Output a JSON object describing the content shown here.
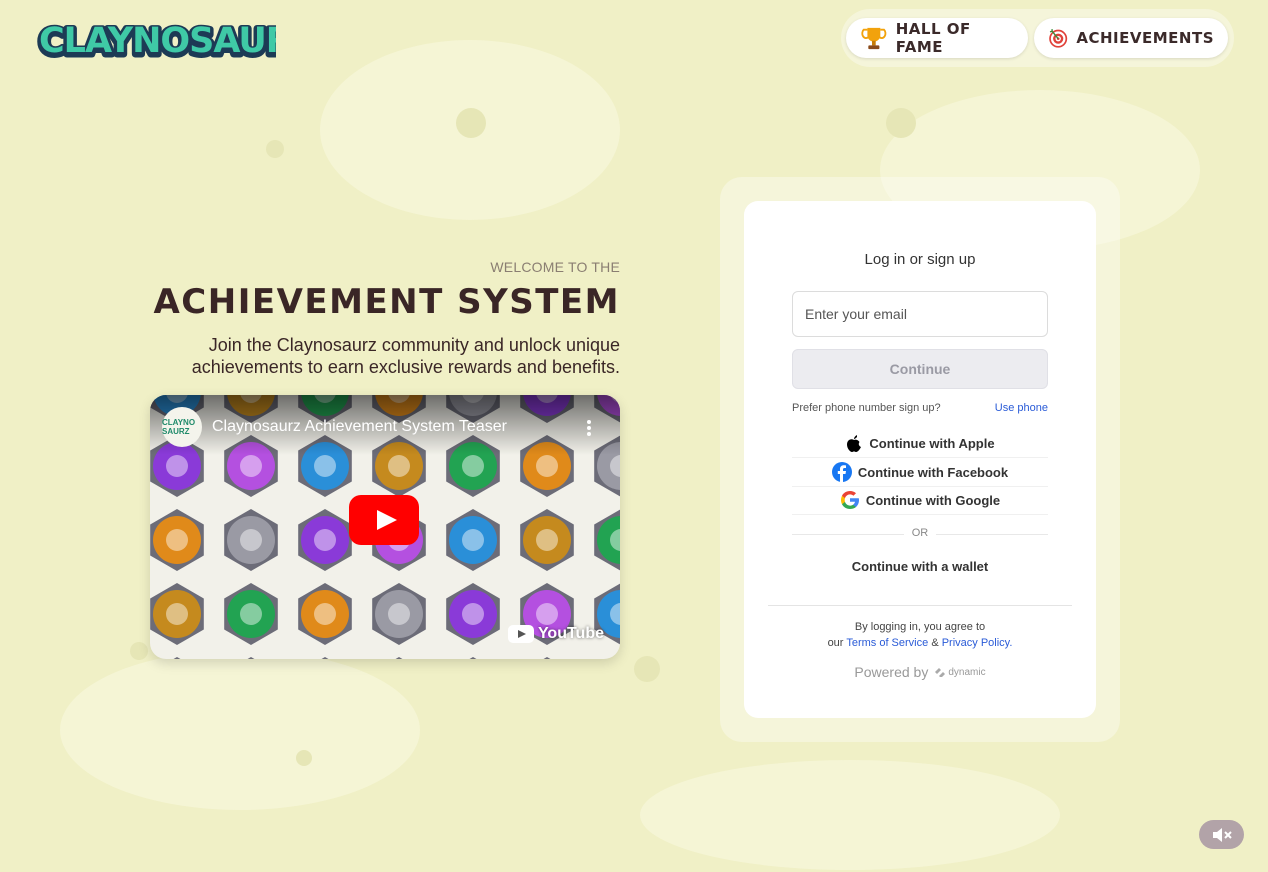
{
  "brand": {
    "logo_text": "CLAYNOSAURZ"
  },
  "nav": {
    "hall_of_fame": "HALL OF FAME",
    "achievements": "ACHIEVEMENTS"
  },
  "hero": {
    "welcome": "WELCOME TO THE",
    "title": "ACHIEVEMENT SYSTEM",
    "subtitle": "Join the Claynosaurz community and unlock unique achievements to earn exclusive rewards and benefits."
  },
  "video": {
    "title": "Claynosaurz Achievement System Teaser",
    "channel_avatar_text": "CLAYNO SAURZ",
    "brand": "YouTube"
  },
  "login": {
    "heading": "Log in or sign up",
    "email_placeholder": "Enter your email",
    "continue": "Continue",
    "prefer_phone": "Prefer phone number sign up?",
    "use_phone": "Use phone",
    "apple": "Continue with Apple",
    "facebook": "Continue with Facebook",
    "google": "Continue with Google",
    "or": "OR",
    "wallet": "Continue with a wallet",
    "terms_prefix": "By logging in, you agree to",
    "terms_our": "our",
    "terms_of_service": "Terms of Service",
    "terms_and": "&",
    "privacy_policy": "Privacy Policy.",
    "powered_by": "Powered by",
    "powered_brand": "dynamic"
  },
  "colors": {
    "background": "#f0f0c6",
    "title_text": "#3a2626",
    "link": "#2a5bd7",
    "logo_fill": "#3fc9a6",
    "logo_outline": "#1d3a55"
  },
  "icons": [
    "trophy-icon",
    "target-icon",
    "youtube-play-icon",
    "apple-icon",
    "facebook-icon",
    "google-icon",
    "mute-icon"
  ]
}
